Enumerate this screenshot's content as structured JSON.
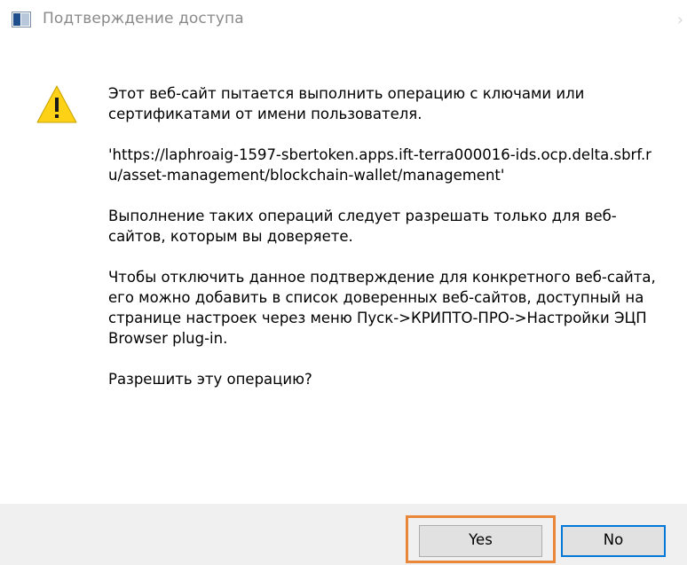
{
  "window": {
    "title": "Подтверждение доступа",
    "icon": "app-window-icon"
  },
  "body": {
    "icon": "warning-icon",
    "paragraphs": [
      "Этот веб-сайт пытается выполнить операцию с ключами или сертификатами от имени пользователя.",
      "'https://laphroaig-1597-sbertoken.apps.ift-terra000016-ids.ocp.delta.sbrf.ru/asset-management/blockchain-wallet/management'",
      "Выполнение таких операций следует разрешать только для веб-сайтов, которым вы доверяете.",
      "Чтобы отключить данное подтверждение для конкретного веб-сайта, его можно добавить в список доверенных веб-сайтов, доступный на странице настроек через меню Пуск->КРИПТО-ПРО->Настройки ЭЦП Browser plug-in.",
      "Разрешить эту операцию?"
    ]
  },
  "buttons": {
    "yes_label": "Yes",
    "no_label": "No"
  },
  "colors": {
    "highlight": "#e8873a",
    "focus_border": "#0078d7",
    "warning_fill": "#fcd116"
  }
}
